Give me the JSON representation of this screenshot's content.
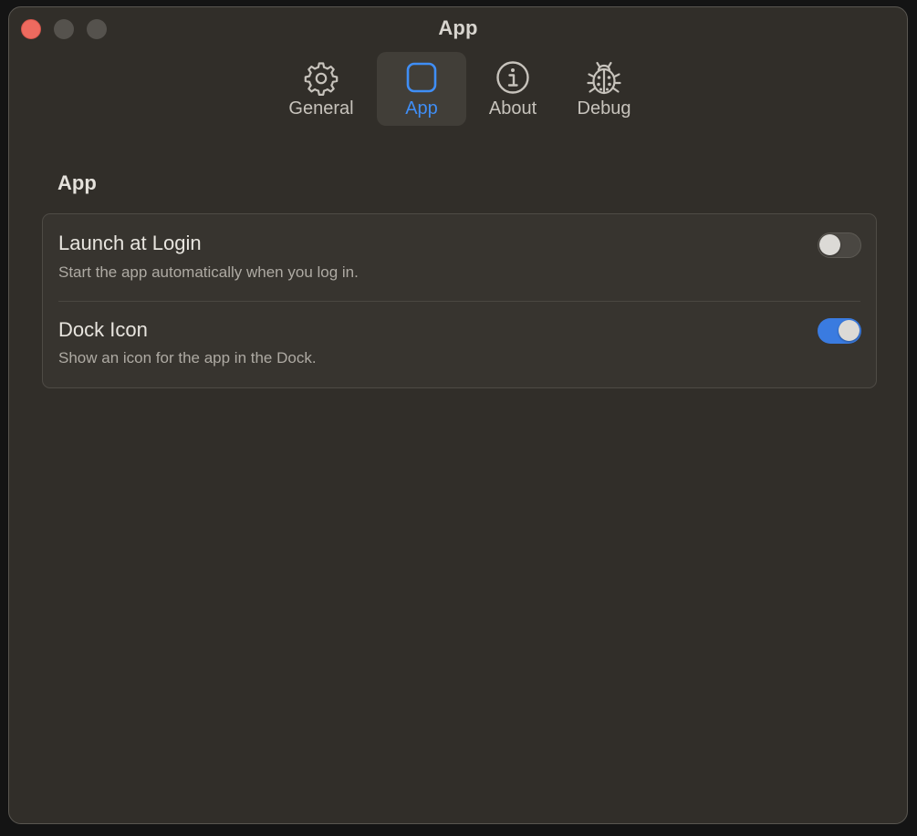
{
  "window": {
    "title": "App"
  },
  "toolbar": {
    "tabs": [
      {
        "label": "General",
        "icon": "gear-icon",
        "active": false
      },
      {
        "label": "App",
        "icon": "app-square-icon",
        "active": true
      },
      {
        "label": "About",
        "icon": "info-circle-icon",
        "active": false
      },
      {
        "label": "Debug",
        "icon": "ladybug-icon",
        "active": false
      }
    ]
  },
  "section": {
    "title": "App",
    "settings": [
      {
        "title": "Launch at Login",
        "description": "Start the app automatically when you log in.",
        "enabled": false
      },
      {
        "title": "Dock Icon",
        "description": "Show an icon for the app in the Dock.",
        "enabled": true
      }
    ]
  },
  "colors": {
    "accent": "#3f8ef6",
    "toggle_on": "#3a7be0",
    "window_bg": "#312e29",
    "close_button": "#ee6a5f"
  }
}
